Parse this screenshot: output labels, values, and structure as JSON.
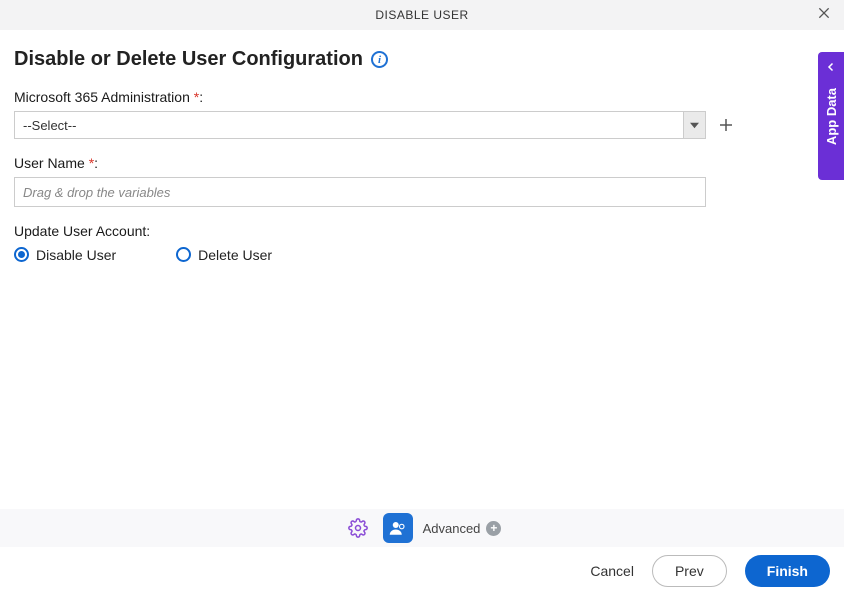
{
  "header": {
    "title": "DISABLE USER"
  },
  "page": {
    "title": "Disable or Delete User Configuration"
  },
  "fields": {
    "admin": {
      "label": "Microsoft 365 Administration",
      "value": "--Select--"
    },
    "username": {
      "label": "User Name",
      "placeholder": "Drag & drop the variables"
    },
    "update": {
      "label": "Update User Account:"
    }
  },
  "radios": {
    "disable": "Disable User",
    "delete": "Delete User"
  },
  "sidetab": {
    "label": "App Data"
  },
  "toolbar": {
    "advanced": "Advanced"
  },
  "footer": {
    "cancel": "Cancel",
    "prev": "Prev",
    "finish": "Finish"
  }
}
